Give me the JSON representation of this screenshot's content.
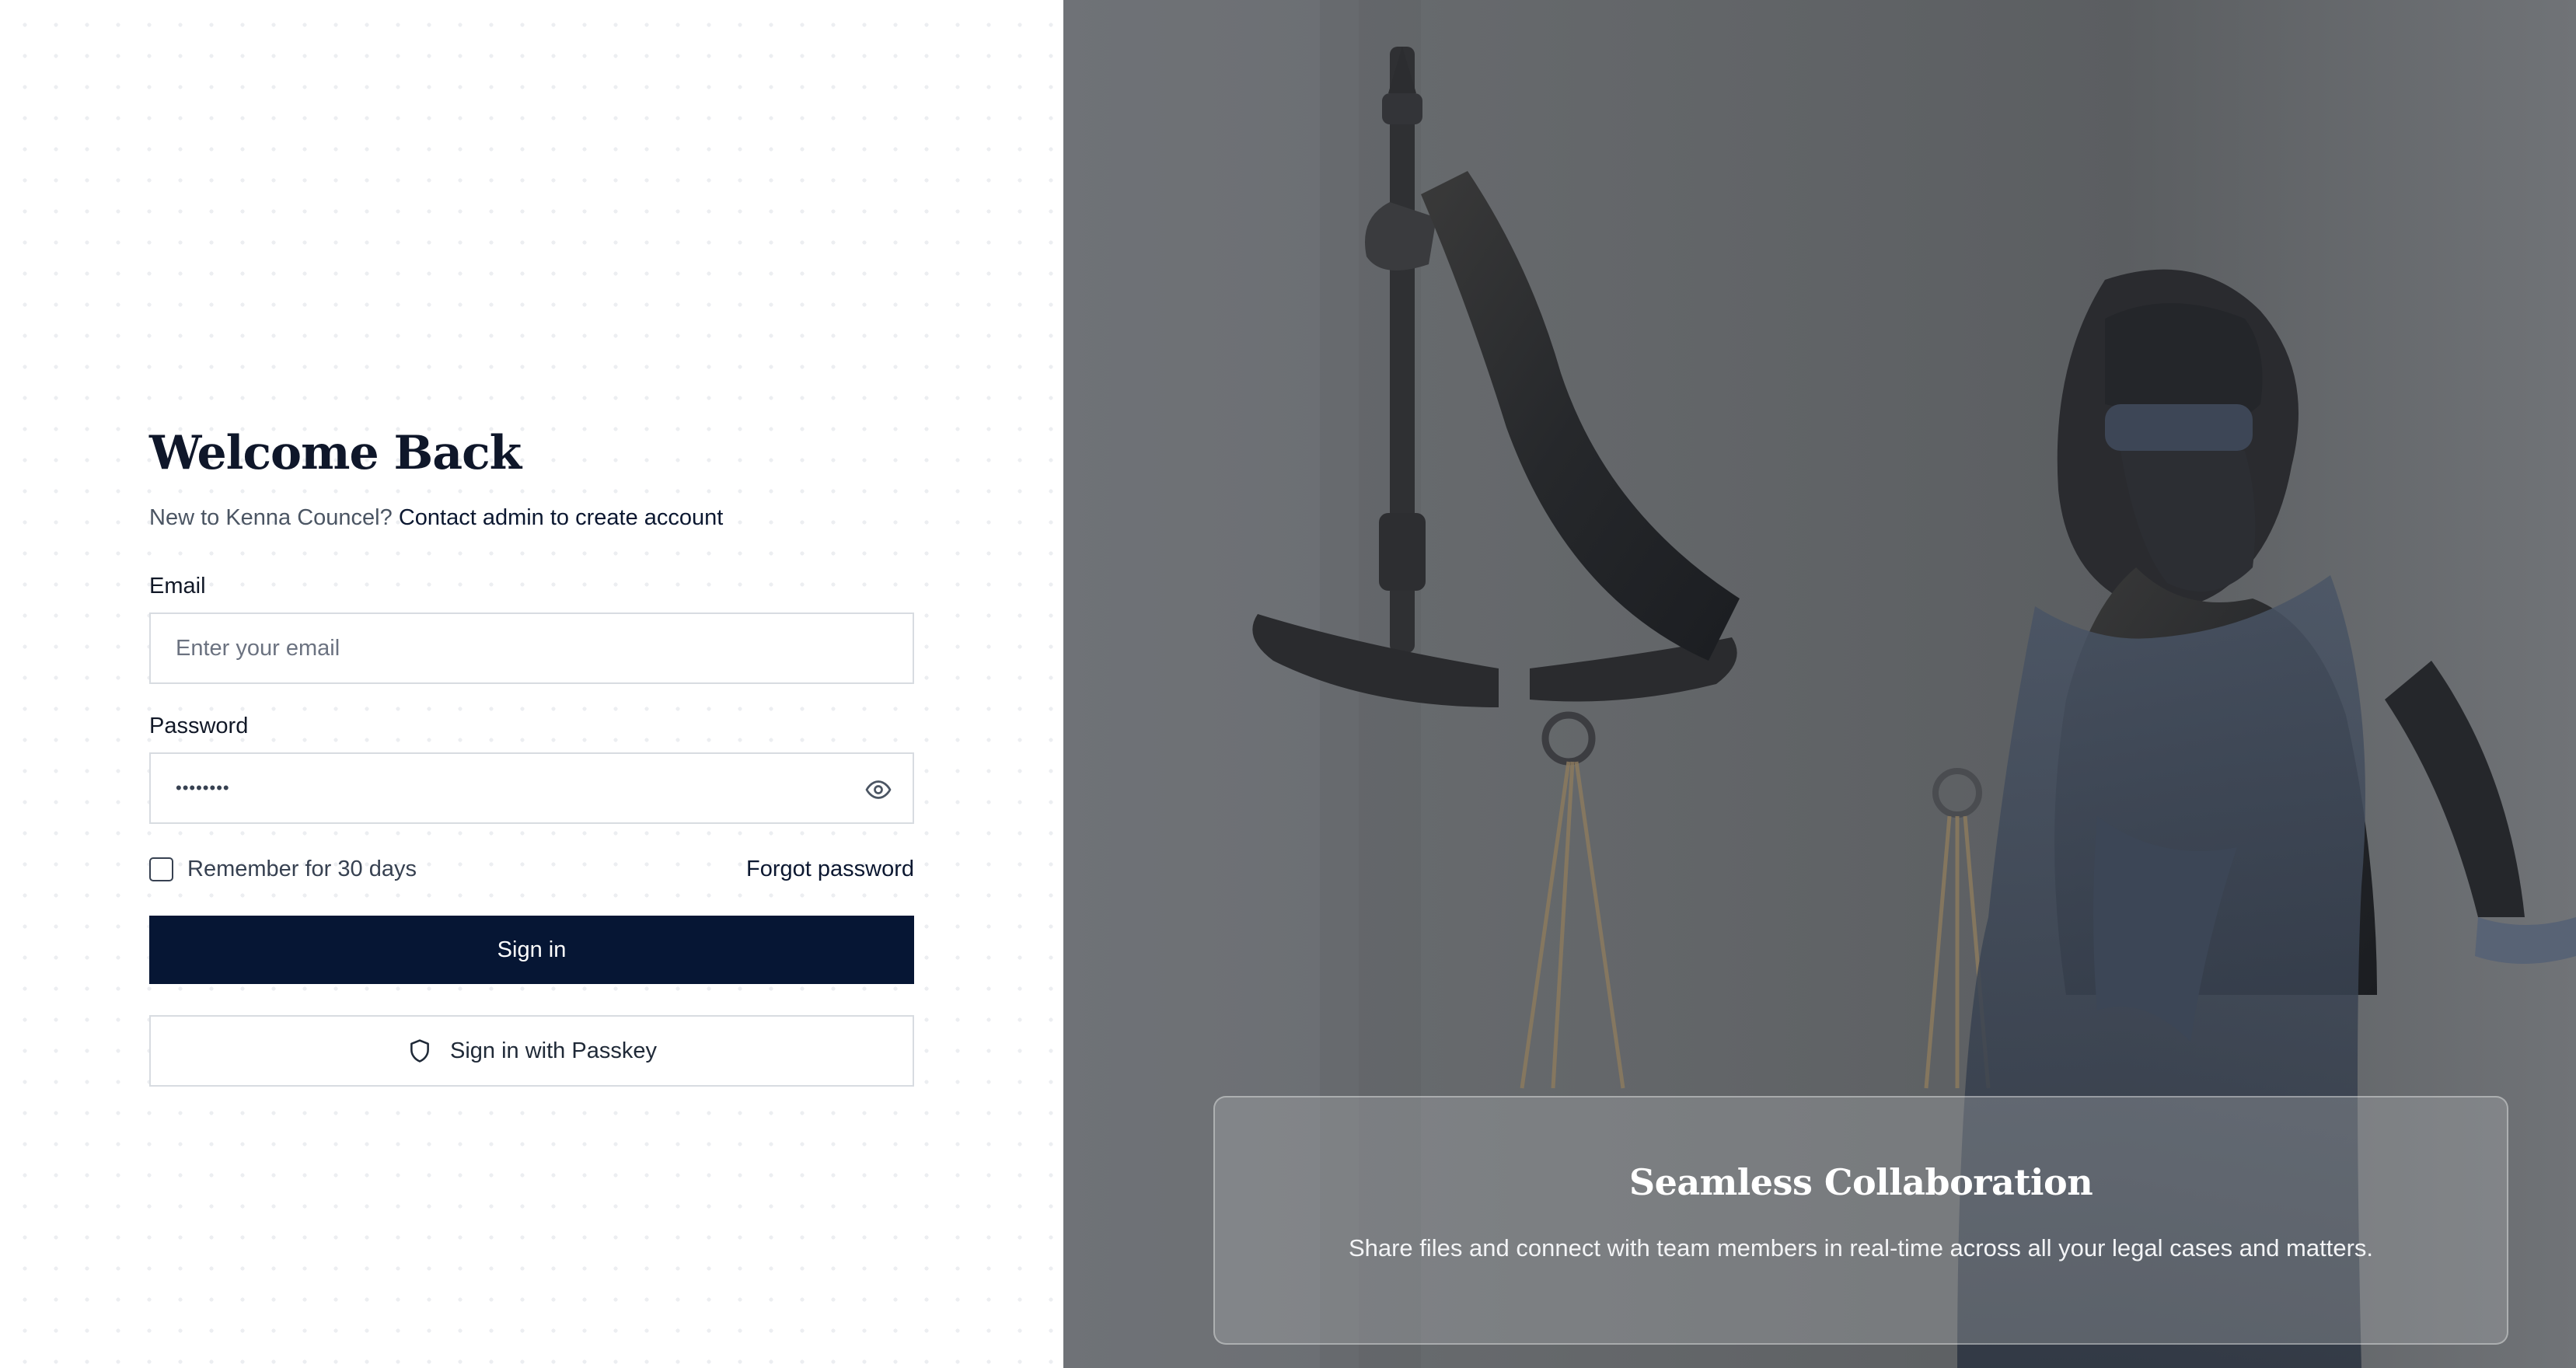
{
  "login": {
    "title": "Welcome Back",
    "subtitle_prefix": "New to Kenna Councel?",
    "subtitle_link": "Contact admin to create account",
    "email_label": "Email",
    "email_placeholder": "Enter your email",
    "email_value": "",
    "password_label": "Password",
    "password_value": "••••••••",
    "remember_label": "Remember for 30 days",
    "forgot_label": "Forgot password",
    "signin_label": "Sign in",
    "passkey_label": "Sign in with Passkey"
  },
  "hero": {
    "card_title": "Seamless Collaboration",
    "card_text": "Share files and connect with team members in real-time across all your legal cases and matters."
  },
  "icons": {
    "password_toggle": "eye-icon",
    "passkey": "shield-icon"
  },
  "colors": {
    "primary_button": "#061634",
    "link": "#0b1730",
    "border": "#d8dce1"
  }
}
